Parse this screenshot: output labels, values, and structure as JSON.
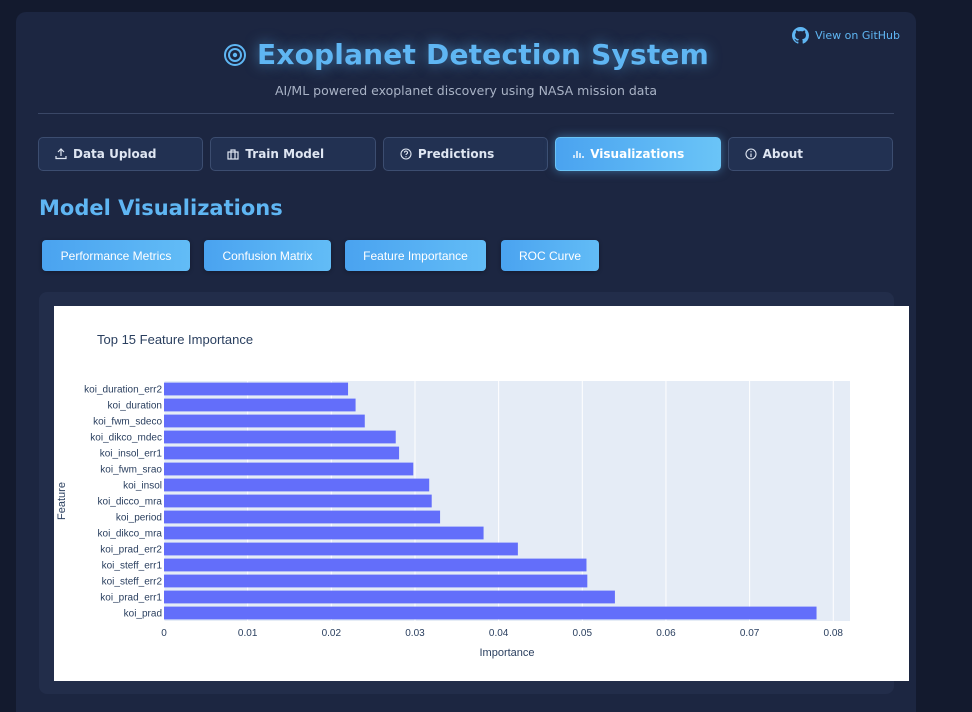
{
  "github": {
    "label": "View on GitHub"
  },
  "header": {
    "title": "Exoplanet Detection System",
    "subtitle": "AI/ML powered exoplanet discovery using NASA mission data"
  },
  "nav": {
    "tabs": [
      {
        "label": "Data Upload",
        "icon": "upload-icon",
        "active": false
      },
      {
        "label": "Train Model",
        "icon": "model-icon",
        "active": false
      },
      {
        "label": "Predictions",
        "icon": "help-circle-icon",
        "active": false
      },
      {
        "label": "Visualizations",
        "icon": "bar-chart-icon",
        "active": true
      },
      {
        "label": "About",
        "icon": "info-icon",
        "active": false
      }
    ]
  },
  "section": {
    "title": "Model Visualizations"
  },
  "viz_buttons": [
    {
      "label": "Performance Metrics"
    },
    {
      "label": "Confusion Matrix"
    },
    {
      "label": "Feature Importance"
    },
    {
      "label": "ROC Curve"
    }
  ],
  "colors": {
    "accent": "#5fb6f3",
    "bar": "#636efa",
    "plot_bg": "#e5ecf6",
    "panel": "#1c2641"
  },
  "chart_data": {
    "type": "bar",
    "orientation": "horizontal",
    "title": "Top 15 Feature Importance",
    "xlabel": "Importance",
    "ylabel": "Feature",
    "xlim": [
      0,
      0.082
    ],
    "xticks": [
      0,
      0.01,
      0.02,
      0.03,
      0.04,
      0.05,
      0.06,
      0.07,
      0.08
    ],
    "xtick_labels": [
      "0",
      "0.01",
      "0.02",
      "0.03",
      "0.04",
      "0.05",
      "0.06",
      "0.07",
      "0.08"
    ],
    "grid": true,
    "categories": [
      "koi_duration_err2",
      "koi_duration",
      "koi_fwm_sdeco",
      "koi_dikco_mdec",
      "koi_insol_err1",
      "koi_fwm_srao",
      "koi_insol",
      "koi_dicco_mra",
      "koi_period",
      "koi_dikco_mra",
      "koi_prad_err2",
      "koi_steff_err1",
      "koi_steff_err2",
      "koi_prad_err1",
      "koi_prad"
    ],
    "values": [
      0.022,
      0.0229,
      0.024,
      0.0277,
      0.0281,
      0.0298,
      0.0317,
      0.032,
      0.033,
      0.0382,
      0.0423,
      0.0505,
      0.0506,
      0.0539,
      0.078
    ]
  }
}
